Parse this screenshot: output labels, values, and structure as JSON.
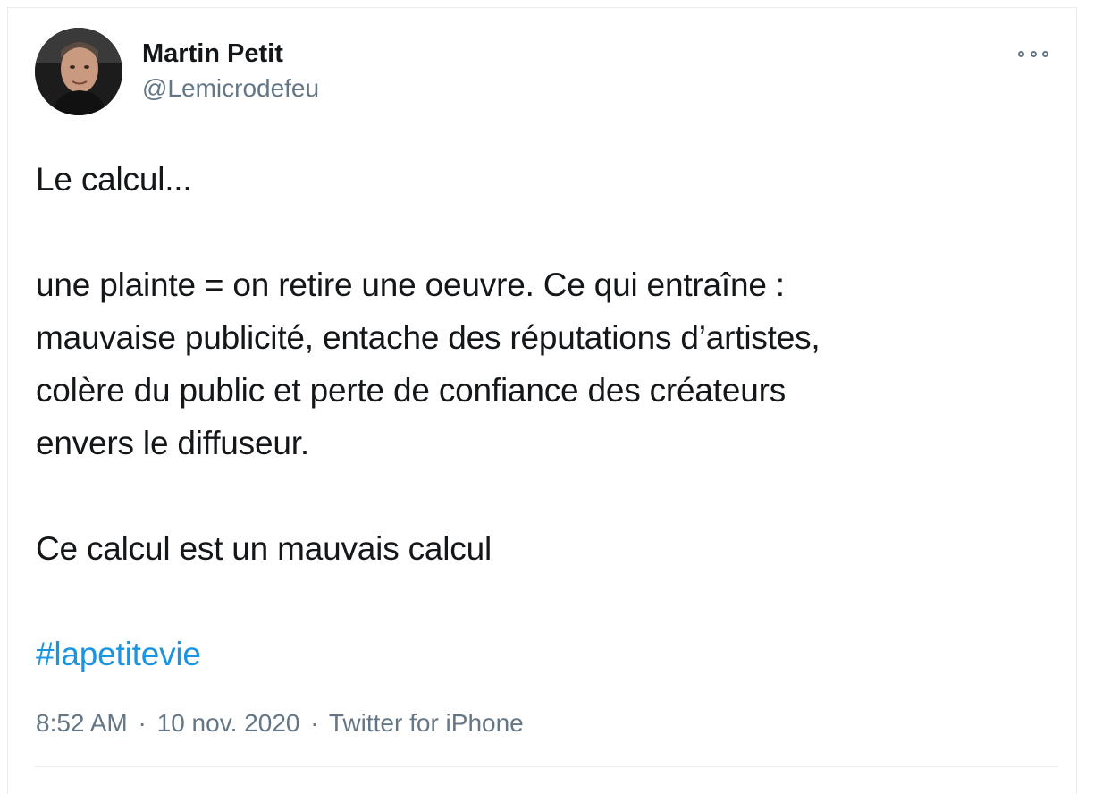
{
  "author": {
    "name": "Martin Petit",
    "handle": "@Lemicrodefeu",
    "avatar_icon": "profile-photo"
  },
  "menu_icon": "more-options-icon",
  "tweet": {
    "line1": "Le calcul...",
    "line2": "une plainte = on retire une oeuvre. Ce qui entraîne :",
    "line3": "mauvaise publicité, entache des réputations d’artistes,",
    "line4": "colère du public et perte de confiance des créateurs",
    "line5": "envers le diffuseur.",
    "line6": "Ce calcul est un mauvais calcul",
    "hashtag": "#lapetitevie"
  },
  "meta": {
    "time": "8:52 AM",
    "date": "10 nov. 2020",
    "separator": "·",
    "source": "Twitter for iPhone"
  },
  "colors": {
    "hashtag": "#1b95e0",
    "secondary_text": "#657786",
    "primary_text": "#14171a",
    "border": "#e6ecf0"
  }
}
